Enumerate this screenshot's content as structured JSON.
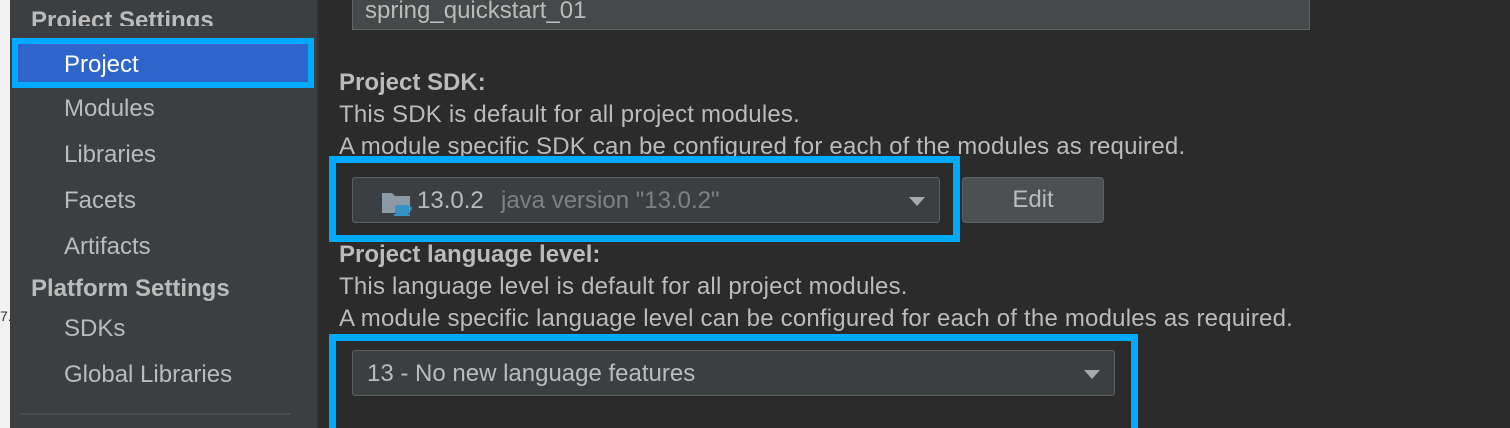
{
  "left_edge": {
    "glyph": "7."
  },
  "sidebar": {
    "project_settings_header": "Project Settings",
    "project_settings_items": [
      {
        "label": "Project"
      },
      {
        "label": "Modules"
      },
      {
        "label": "Libraries"
      },
      {
        "label": "Facets"
      },
      {
        "label": "Artifacts"
      }
    ],
    "platform_settings_header": "Platform Settings",
    "platform_settings_items": [
      {
        "label": "SDKs"
      },
      {
        "label": "Global Libraries"
      }
    ],
    "selected_item": "Project"
  },
  "main": {
    "project_name_value": "spring_quickstart_01",
    "sdk": {
      "heading": "Project SDK:",
      "desc_line1": "This SDK is default for all project modules.",
      "desc_line2": "A module specific SDK can be configured for each of the modules as required.",
      "selected_version": "13.0.2",
      "selected_detail": "java version \"13.0.2\"",
      "icon": "folder-java-icon",
      "edit_label": "Edit"
    },
    "language_level": {
      "heading": "Project language level:",
      "desc_line1": "This language level is default for all project modules.",
      "desc_line2": "A module specific language level can be configured for each of the modules as required.",
      "selected_value": "13 - No new language features"
    }
  },
  "colors": {
    "highlight": "#00aaff",
    "selection": "#2f65ca",
    "background": "#2b2b2b",
    "sidebar": "#3c3f41"
  }
}
